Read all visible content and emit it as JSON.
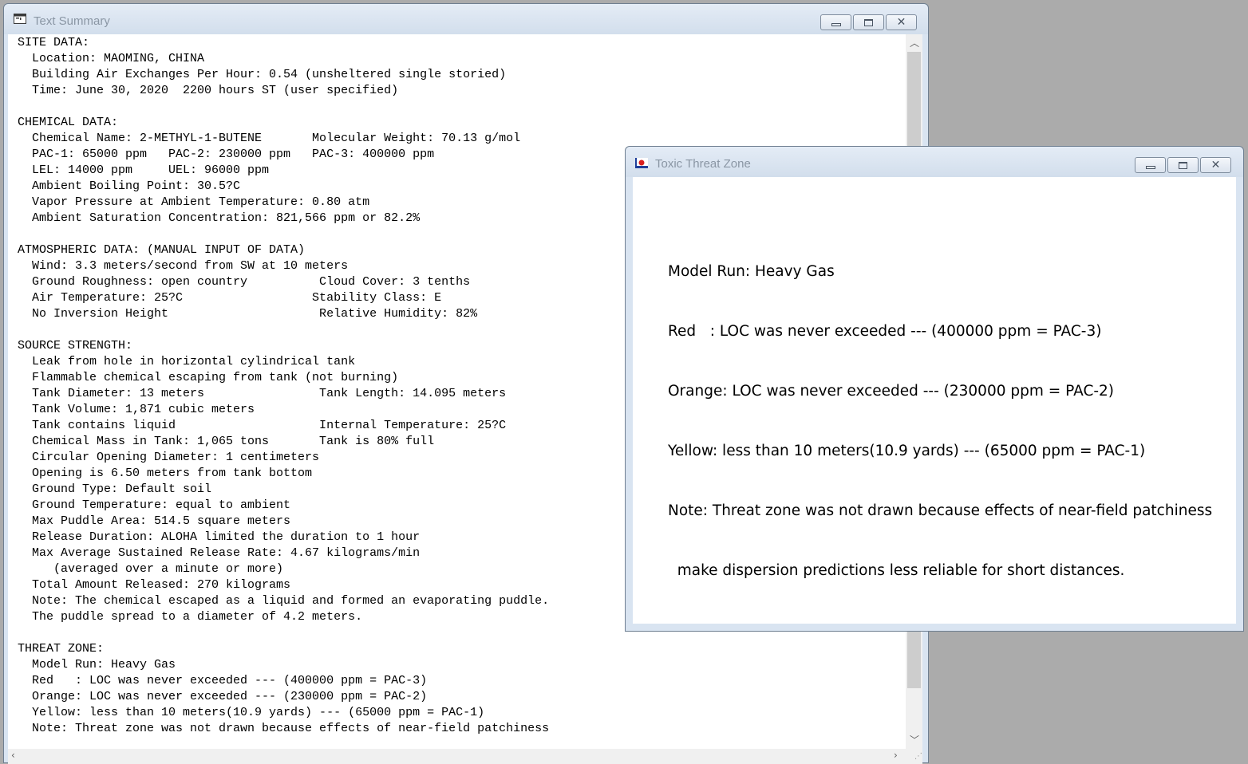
{
  "text_summary_window": {
    "title": "Text Summary",
    "icon": "text-document-icon",
    "controls": {
      "minimize_icon": "minimize-icon",
      "maximize_icon": "maximize-icon",
      "close_icon": "close-icon"
    },
    "lines": [
      "SITE DATA:",
      "  Location: MAOMING, CHINA",
      "  Building Air Exchanges Per Hour: 0.54 (unsheltered single storied)",
      "  Time: June 30, 2020  2200 hours ST (user specified)",
      "",
      "CHEMICAL DATA:",
      "  Chemical Name: 2-METHYL-1-BUTENE       Molecular Weight: 70.13 g/mol",
      "  PAC-1: 65000 ppm   PAC-2: 230000 ppm   PAC-3: 400000 ppm",
      "  LEL: 14000 ppm     UEL: 96000 ppm",
      "  Ambient Boiling Point: 30.5?C",
      "  Vapor Pressure at Ambient Temperature: 0.80 atm",
      "  Ambient Saturation Concentration: 821,566 ppm or 82.2%",
      "",
      "ATMOSPHERIC DATA: (MANUAL INPUT OF DATA)",
      "  Wind: 3.3 meters/second from SW at 10 meters",
      "  Ground Roughness: open country          Cloud Cover: 3 tenths",
      "  Air Temperature: 25?C                  Stability Class: E",
      "  No Inversion Height                     Relative Humidity: 82%",
      "",
      "SOURCE STRENGTH:",
      "  Leak from hole in horizontal cylindrical tank",
      "  Flammable chemical escaping from tank (not burning)",
      "  Tank Diameter: 13 meters                Tank Length: 14.095 meters",
      "  Tank Volume: 1,871 cubic meters",
      "  Tank contains liquid                    Internal Temperature: 25?C",
      "  Chemical Mass in Tank: 1,065 tons       Tank is 80% full",
      "  Circular Opening Diameter: 1 centimeters",
      "  Opening is 6.50 meters from tank bottom",
      "  Ground Type: Default soil",
      "  Ground Temperature: equal to ambient",
      "  Max Puddle Area: 514.5 square meters",
      "  Release Duration: ALOHA limited the duration to 1 hour",
      "  Max Average Sustained Release Rate: 4.67 kilograms/min",
      "     (averaged over a minute or more)",
      "  Total Amount Released: 270 kilograms",
      "  Note: The chemical escaped as a liquid and formed an evaporating puddle.",
      "  The puddle spread to a diameter of 4.2 meters.",
      "",
      "THREAT ZONE:",
      "  Model Run: Heavy Gas",
      "  Red   : LOC was never exceeded --- (400000 ppm = PAC-3)",
      "  Orange: LOC was never exceeded --- (230000 ppm = PAC-2)",
      "  Yellow: less than 10 meters(10.9 yards) --- (65000 ppm = PAC-1)",
      "  Note: Threat zone was not drawn because effects of near-field patchiness"
    ],
    "scroll_up_icon": "chevron-up-icon",
    "scroll_down_icon": "chevron-down-icon",
    "scroll_left_icon": "chevron-left-icon",
    "scroll_right_icon": "chevron-right-icon",
    "resize_grip_icon": "resize-grip-icon"
  },
  "toxic_threat_zone_window": {
    "title": "Toxic Threat Zone",
    "icon": "threat-zone-icon",
    "controls": {
      "minimize_icon": "minimize-icon",
      "maximize_icon": "maximize-icon",
      "close_icon": "close-icon"
    },
    "model_run": "Model Run: Heavy Gas",
    "red": "Red   : LOC was never exceeded --- (400000 ppm = PAC-3)",
    "orange": "Orange: LOC was never exceeded --- (230000 ppm = PAC-2)",
    "yellow": "Yellow: less than 10 meters(10.9 yards) --- (65000 ppm = PAC-1)",
    "note_line1": "Note: Threat zone was not drawn because effects of near-field patchiness",
    "note_line2": "  make dispersion predictions less reliable for short distances."
  }
}
